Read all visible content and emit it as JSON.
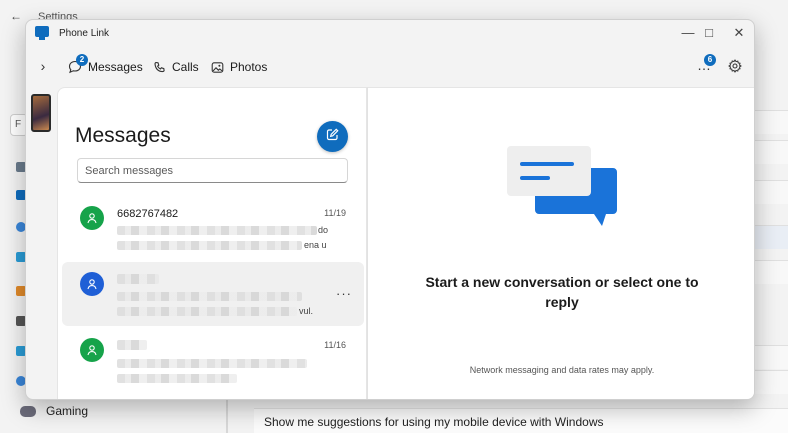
{
  "background": {
    "title": "Settings",
    "gaming_label": "Gaming",
    "suggestion_text": "Show me suggestions for using my mobile device with Windows"
  },
  "window": {
    "title": "Phone Link",
    "controls": {
      "minimize": "—",
      "maximize": "□",
      "close": "✕"
    }
  },
  "nav": {
    "expand": "›",
    "tabs": [
      {
        "label": "Messages",
        "icon": "chat-icon",
        "badge": "2",
        "selected": true
      },
      {
        "label": "Calls",
        "icon": "phone-icon"
      },
      {
        "label": "Photos",
        "icon": "photo-icon"
      }
    ],
    "more": "…",
    "more_badge": "6",
    "settings_icon": "gear-icon"
  },
  "messages": {
    "heading": "Messages",
    "search_placeholder": "Search messages",
    "conversations": [
      {
        "name": "6682767482",
        "date": "11/19",
        "snippet_end_1": "do",
        "snippet_end_2": "ena u"
      },
      {
        "name": "",
        "date": "",
        "snippet_end_2": "vul."
      },
      {
        "name": "",
        "date": "11/16"
      }
    ]
  },
  "detail": {
    "empty_title": "Start a new conversation or select one to reply",
    "network_note": "Network messaging and data rates may apply."
  },
  "colors": {
    "accent": "#0f6cbd",
    "avatar_green": "#16a34a",
    "avatar_blue": "#1f5fd6"
  }
}
